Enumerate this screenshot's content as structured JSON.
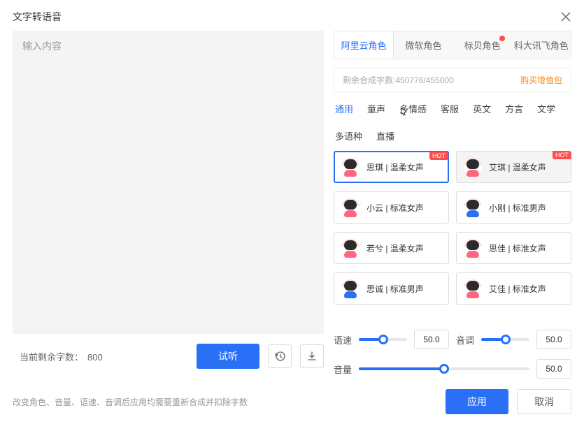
{
  "header": {
    "title": "文字转语音"
  },
  "input": {
    "placeholder": "输入内容",
    "char_count_label": "当前剩余字数：",
    "char_count_value": "800"
  },
  "left_actions": {
    "listen": "试听"
  },
  "providers": [
    {
      "label": "阿里云角色",
      "active": true
    },
    {
      "label": "微软角色"
    },
    {
      "label": "标贝角色",
      "dot": true
    },
    {
      "label": "科大讯飞角色"
    }
  ],
  "credit": {
    "label": "剩余合成字数:450776/455000",
    "buy": "购买增值包"
  },
  "categories": [
    "通用",
    "童声",
    "多情感",
    "客服",
    "英文",
    "方言",
    "文学",
    "多语种",
    "直播"
  ],
  "active_category": 0,
  "voices": [
    {
      "name": "思琪",
      "desc": "温柔女声",
      "gender": "female",
      "hot": true,
      "active": true
    },
    {
      "name": "艾琪",
      "desc": "温柔女声",
      "gender": "female",
      "hot": true,
      "muted": true
    },
    {
      "name": "小云",
      "desc": "标准女声",
      "gender": "female"
    },
    {
      "name": "小刚",
      "desc": "标准男声",
      "gender": "male"
    },
    {
      "name": "若兮",
      "desc": "温柔女声",
      "gender": "female"
    },
    {
      "name": "思佳",
      "desc": "标准女声",
      "gender": "female"
    },
    {
      "name": "思诚",
      "desc": "标准男声",
      "gender": "male"
    },
    {
      "name": "艾佳",
      "desc": "标准女声",
      "gender": "female"
    }
  ],
  "sliders": {
    "speed_label": "语速",
    "speed_value": "50.0",
    "speed_pct": 50,
    "pitch_label": "音调",
    "pitch_value": "50.0",
    "pitch_pct": 50,
    "volume_label": "音量",
    "volume_value": "50.0",
    "volume_pct": 50
  },
  "footer": {
    "warning": "改变角色、音量、语速、音调后应用均需要重新合成并扣除字数",
    "apply": "应用",
    "cancel": "取消"
  },
  "hot_label": "HOT"
}
